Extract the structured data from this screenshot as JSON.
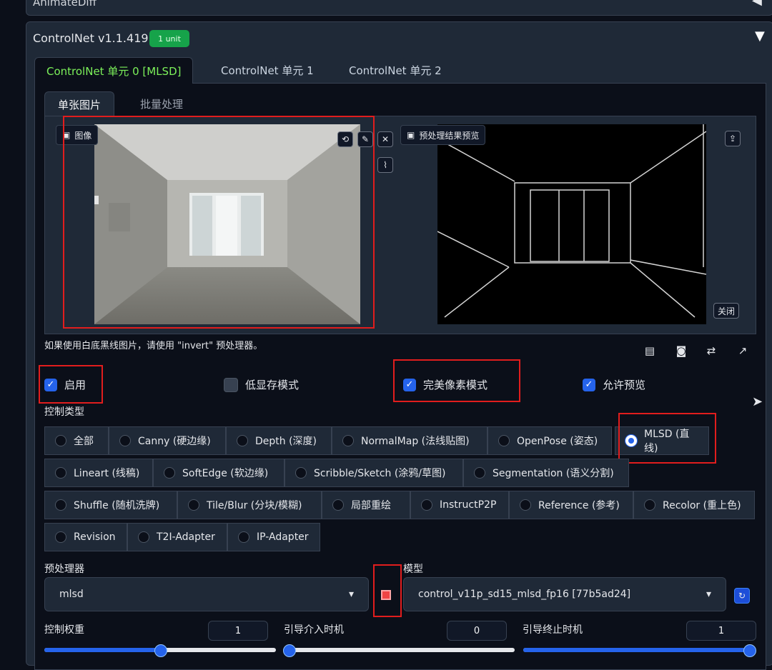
{
  "top_panel": {
    "title": "AnimateDiff"
  },
  "controlnet": {
    "title": "ControlNet v1.1.419",
    "badge": "1 unit",
    "tabs": [
      "ControlNet 单元 0 [MLSD]",
      "ControlNet 单元 1",
      "ControlNet 单元 2"
    ],
    "sub_tabs": [
      "单张图片",
      "批量处理"
    ],
    "image_label": "图像",
    "preview_label": "预处理结果预览",
    "close_preview": "关闭",
    "hint": "如果使用白底黑线图片，请使用 \"invert\" 预处理器。",
    "checkboxes": [
      {
        "label": "启用",
        "checked": true
      },
      {
        "label": "低显存模式",
        "checked": false
      },
      {
        "label": "完美像素模式",
        "checked": true
      },
      {
        "label": "允许预览",
        "checked": true
      }
    ],
    "control_type_label": "控制类型",
    "control_types": [
      "全部",
      "Canny (硬边缘)",
      "Depth (深度)",
      "NormalMap (法线贴图)",
      "OpenPose (姿态)",
      "MLSD (直线)",
      "Lineart (线稿)",
      "SoftEdge (软边缘)",
      "Scribble/Sketch (涂鸦/草图)",
      "Segmentation (语义分割)",
      "Shuffle (随机洗牌)",
      "Tile/Blur (分块/模糊)",
      "局部重绘",
      "InstructP2P",
      "Reference (参考)",
      "Recolor (重上色)",
      "Revision",
      "T2I-Adapter",
      "IP-Adapter"
    ],
    "selected_control_type": "MLSD (直线)",
    "preprocessor_label": "预处理器",
    "preprocessor_value": "mlsd",
    "model_label": "模型",
    "model_value": "control_v11p_sd15_mlsd_fp16 [77b5ad24]",
    "sliders": [
      {
        "label": "控制权重",
        "value": "1",
        "fraction": 0.5
      },
      {
        "label": "引导介入时机",
        "value": "0",
        "fraction": 0.0
      },
      {
        "label": "引导终止时机",
        "value": "1",
        "fraction": 1.0
      }
    ]
  },
  "colors": {
    "accent": "#2563eb",
    "active_tab": "#7cf05a",
    "badge": "#16a34a",
    "highlight": "#e11d1d"
  }
}
